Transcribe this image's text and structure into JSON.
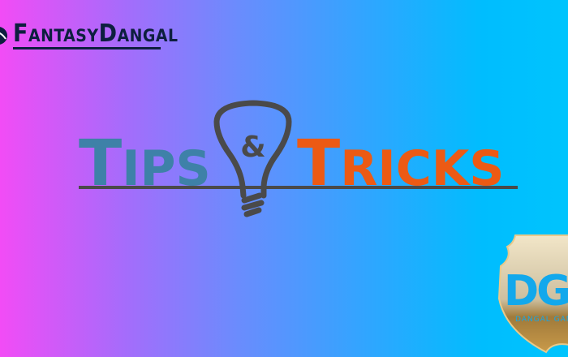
{
  "brand": {
    "first": "F",
    "rest": "ANTASY",
    "second": "D",
    "rest2": "ANGAL"
  },
  "title": {
    "word1_initial": "T",
    "word1_rest": "IPS",
    "ampersand": "&",
    "word2_initial": "T",
    "word2_rest": "RICKS"
  },
  "badge": {
    "monogram": "DG",
    "label": "DANGAL GAMES"
  },
  "colors": {
    "tips": "#3e81a8",
    "tricks": "#ec5a14",
    "line": "#4a4a4a",
    "brand": "#0d1f3f"
  }
}
